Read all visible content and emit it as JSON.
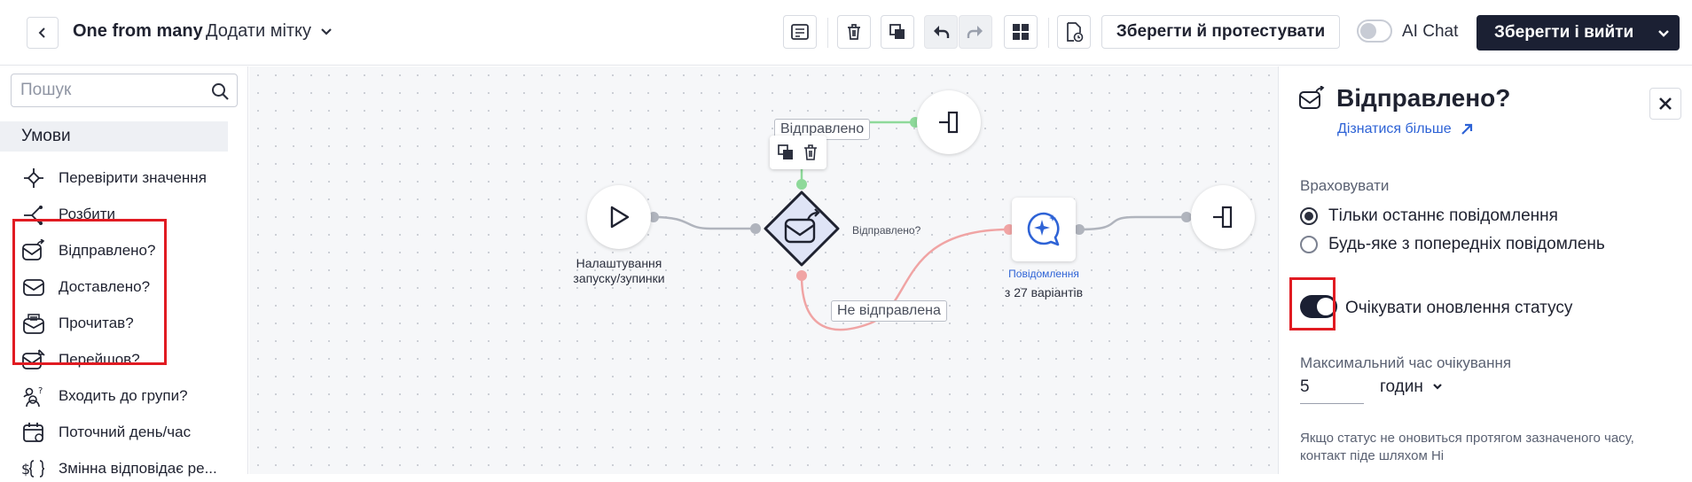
{
  "header": {
    "flow_title": "One from many",
    "add_tag_label": "Додати мітку",
    "save_test_label": "Зберегти й протестувати",
    "ai_chat_label": "AI Chat",
    "save_exit_label": "Зберегти і вийти"
  },
  "sidebar": {
    "search_placeholder": "Пошук",
    "section_title": "Умови",
    "items": [
      {
        "label": "Перевірити значення",
        "icon": "check-value-icon"
      },
      {
        "label": "Розбити",
        "icon": "split-icon"
      },
      {
        "label": "Відправлено?",
        "icon": "sent-icon"
      },
      {
        "label": "Доставлено?",
        "icon": "delivered-icon"
      },
      {
        "label": "Прочитав?",
        "icon": "read-icon"
      },
      {
        "label": "Перейшов?",
        "icon": "clicked-icon"
      },
      {
        "label": "Входить до групи?",
        "icon": "group-icon"
      },
      {
        "label": "Поточний день/час",
        "icon": "calendar-icon"
      },
      {
        "label": "Змінна відповідає ре...",
        "icon": "variable-icon"
      }
    ]
  },
  "canvas": {
    "start_node_label_1": "Налаштування",
    "start_node_label_2": "запуску/зупинки",
    "edge_sent": "Відправлено",
    "edge_not_sent": "Не відправлена",
    "condition_mini_label": "Відправлено?",
    "message_node_label": "Повідомлення",
    "message_node_variants": "з 27 варіантів"
  },
  "panel": {
    "title": "Відправлено?",
    "learn_more": "Дізнатися більше",
    "consider_label": "Враховувати",
    "option_last": "Тільки останнє повідомлення",
    "option_any": "Будь-яке з попередніх повідомлень",
    "wait_status_label": "Очікувати оновлення статусу",
    "max_wait_label": "Максимальний час очікування",
    "max_wait_value": "5",
    "max_wait_unit": "годин",
    "hint": "Якщо статус не оновиться протягом зазначеного часу, контакт піде шляхом Ні"
  },
  "colors": {
    "primary_dark": "#1b2033",
    "highlight_red": "#e11b22",
    "edge_green": "#8ed99a",
    "edge_red": "#f0a4a4",
    "link_blue": "#2e63d6"
  }
}
